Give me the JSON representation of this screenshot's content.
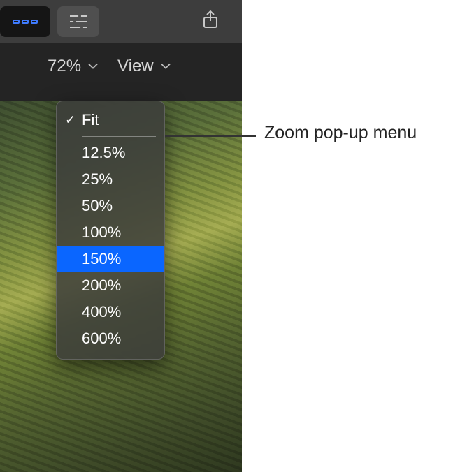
{
  "toolbar": {
    "icons": {
      "clips": "clips-icon",
      "adjust": "sliders-icon",
      "share": "share-icon"
    }
  },
  "secondbar": {
    "zoom_value": "72%",
    "view_label": "View"
  },
  "popup": {
    "fit_label": "Fit",
    "items": [
      "12.5%",
      "25%",
      "50%",
      "100%",
      "150%",
      "200%",
      "400%",
      "600%"
    ],
    "highlighted_index": 4,
    "checked_label": "Fit"
  },
  "callout": {
    "label": "Zoom pop-up menu"
  }
}
